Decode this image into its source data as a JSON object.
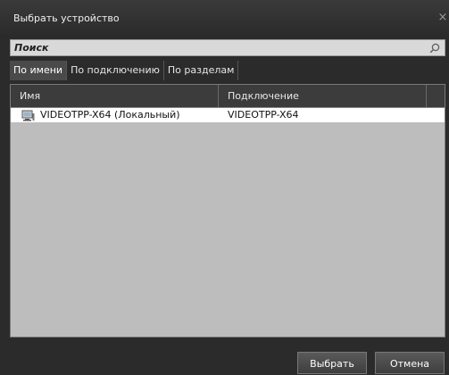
{
  "window": {
    "title": "Выбрать устройство",
    "close_glyph": "×"
  },
  "search": {
    "placeholder": "Поиск",
    "value": ""
  },
  "tabs": [
    {
      "label": "По имени",
      "active": true
    },
    {
      "label": "По подключению",
      "active": false
    },
    {
      "label": "По разделам",
      "active": false
    }
  ],
  "table": {
    "columns": [
      "Имя",
      "Подключение"
    ],
    "rows": [
      {
        "icon": "computer-icon",
        "name": "VIDEOTPP-X64 (Локальный)",
        "connection": "VIDEOTPP-X64"
      }
    ]
  },
  "buttons": {
    "select": "Выбрать",
    "cancel": "Отмена"
  }
}
